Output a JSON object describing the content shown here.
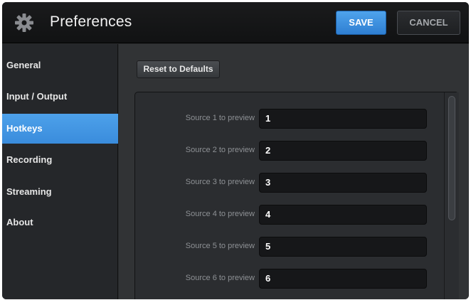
{
  "window": {
    "title": "Preferences",
    "icon": "gear-icon"
  },
  "toolbar": {
    "save_label": "SAVE",
    "cancel_label": "CANCEL"
  },
  "sidebar": {
    "active": "Hotkeys",
    "items": [
      {
        "label": "General"
      },
      {
        "label": "Input / Output"
      },
      {
        "label": "Hotkeys"
      },
      {
        "label": "Recording"
      },
      {
        "label": "Streaming"
      },
      {
        "label": "About"
      }
    ]
  },
  "main": {
    "reset_label": "Reset to Defaults",
    "hotkeys": [
      {
        "label": "Source 1 to preview",
        "value": "1"
      },
      {
        "label": "Source 2 to preview",
        "value": "2"
      },
      {
        "label": "Source 3 to preview",
        "value": "3"
      },
      {
        "label": "Source 4 to preview",
        "value": "4"
      },
      {
        "label": "Source 5 to preview",
        "value": "5"
      },
      {
        "label": "Source 6 to preview",
        "value": "6"
      }
    ]
  },
  "colors": {
    "accent": "#3a8cdc",
    "background": "#2a2c2e",
    "titlebar": "#151617"
  }
}
